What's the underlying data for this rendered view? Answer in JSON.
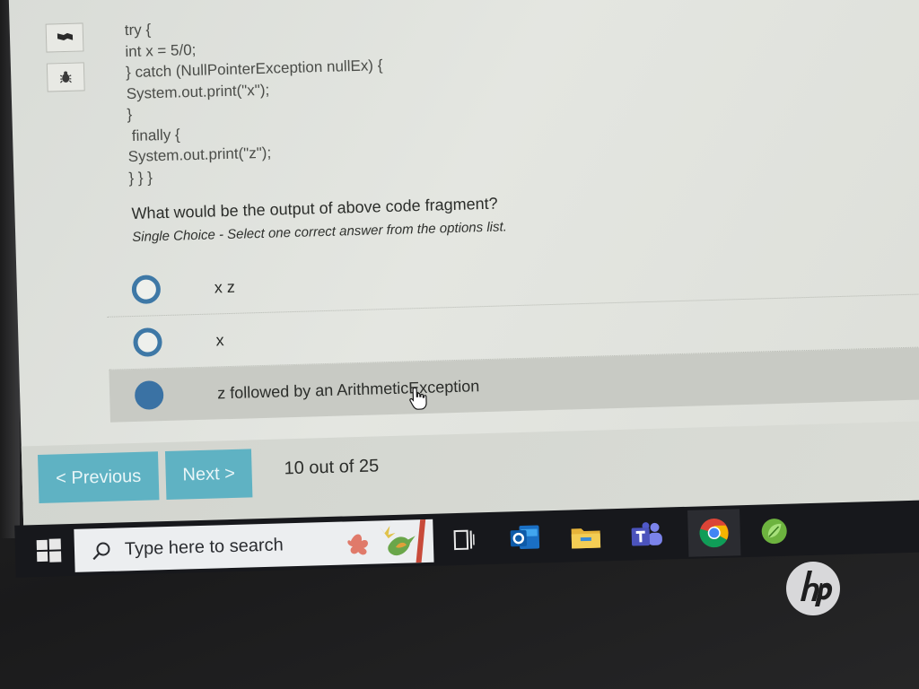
{
  "code_lines": [
    "try {",
    "int x = 5/0;",
    "} catch (NullPointerException nullEx) {",
    "System.out.print(\"x\");",
    "}",
    " finally {",
    "System.out.print(\"z\");",
    "} } }"
  ],
  "question": {
    "text": "What would be the output of above code fragment?",
    "hint": "Single Choice - Select one correct answer from the options list."
  },
  "options": [
    {
      "label": "x z",
      "selected": false
    },
    {
      "label": "x",
      "selected": false
    },
    {
      "label": "z followed by an ArithmeticException",
      "selected": true
    }
  ],
  "nav": {
    "previous_label": "< Previous",
    "next_label": "Next >",
    "progress": "10 out of 25"
  },
  "taskbar": {
    "search_placeholder": "Type here to search",
    "apps": [
      "task-view-icon",
      "outlook-icon",
      "file-explorer-icon",
      "teams-icon",
      "chrome-icon",
      "spring-tool-icon"
    ]
  },
  "colors": {
    "accent_button": "#5fb2c3",
    "radio_blue": "#3e78a6",
    "selected_row": "#c8cac4",
    "taskbar": "#17181c"
  }
}
